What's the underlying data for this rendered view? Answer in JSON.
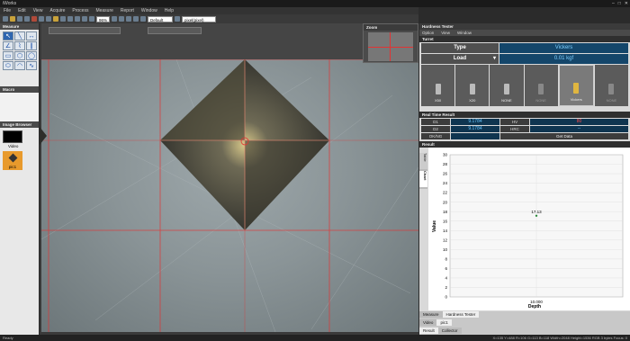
{
  "app": {
    "title": "iWorks",
    "window_controls": [
      "–",
      "□",
      "✕"
    ]
  },
  "menu": [
    "File",
    "Edit",
    "View",
    "Acquire",
    "Process",
    "Measure",
    "Report",
    "Window",
    "Help"
  ],
  "toolbar": {
    "zoom": "96%",
    "layer": "Default",
    "unit": "pixel(pixel)"
  },
  "left_panel": {
    "measure_title": "Measure",
    "macro_title": "Macro",
    "image_browser_title": "Image Browser",
    "thumbs": [
      {
        "label": "Video"
      },
      {
        "label": "pic1"
      }
    ]
  },
  "zoom_panel": {
    "title": "Zoom"
  },
  "hardness": {
    "title": "Hardness Tester",
    "menu": [
      "Option",
      "View",
      "Window"
    ],
    "turret_title": "Turret",
    "type_label": "Type",
    "type_value": "Vickers",
    "load_label": "Load",
    "load_value": "0.01 kgf",
    "turrets": [
      {
        "label": "X50"
      },
      {
        "label": "X20"
      },
      {
        "label": "NONE"
      },
      {
        "label": "NONE"
      },
      {
        "label": "Vickers"
      },
      {
        "label": "NONE"
      }
    ],
    "realtime_title": "Real Time Result",
    "d1_label": "D1",
    "d1_value": "9.1784",
    "d2_label": "D2",
    "d2_value": "9.1784",
    "hv_label": "HV",
    "hv_value": "80",
    "hrc_label": "HRC",
    "hrc_value": "--",
    "okng_label": "OK/NG",
    "getdata_label": "Get Data",
    "result_title": "Result",
    "side_tabs": [
      "Table",
      "Chart"
    ]
  },
  "chart_data": {
    "type": "scatter",
    "title": "",
    "xlabel": "Depth",
    "ylabel": "Value",
    "ylim": [
      0,
      30
    ],
    "yticks": [
      0,
      2,
      4,
      6,
      8,
      10,
      12,
      14,
      16,
      18,
      20,
      22,
      24,
      26,
      28,
      30
    ],
    "x_categories": [
      "10.000"
    ],
    "points": [
      {
        "x": "10.000",
        "y": 17.13,
        "label": "17.13"
      }
    ],
    "grid": true
  },
  "bottom_tabs": {
    "row1": [
      "Measure",
      "Hardness Tester"
    ],
    "row2": [
      "Video",
      "pic1"
    ],
    "row3": [
      "Result",
      "Collector"
    ]
  },
  "status": {
    "left": "Ready",
    "right": "X=135 Y=488  R=106 G=113 B=118  Width=2048 Height=1536  RGB 3 bytes  Focus: 0"
  }
}
